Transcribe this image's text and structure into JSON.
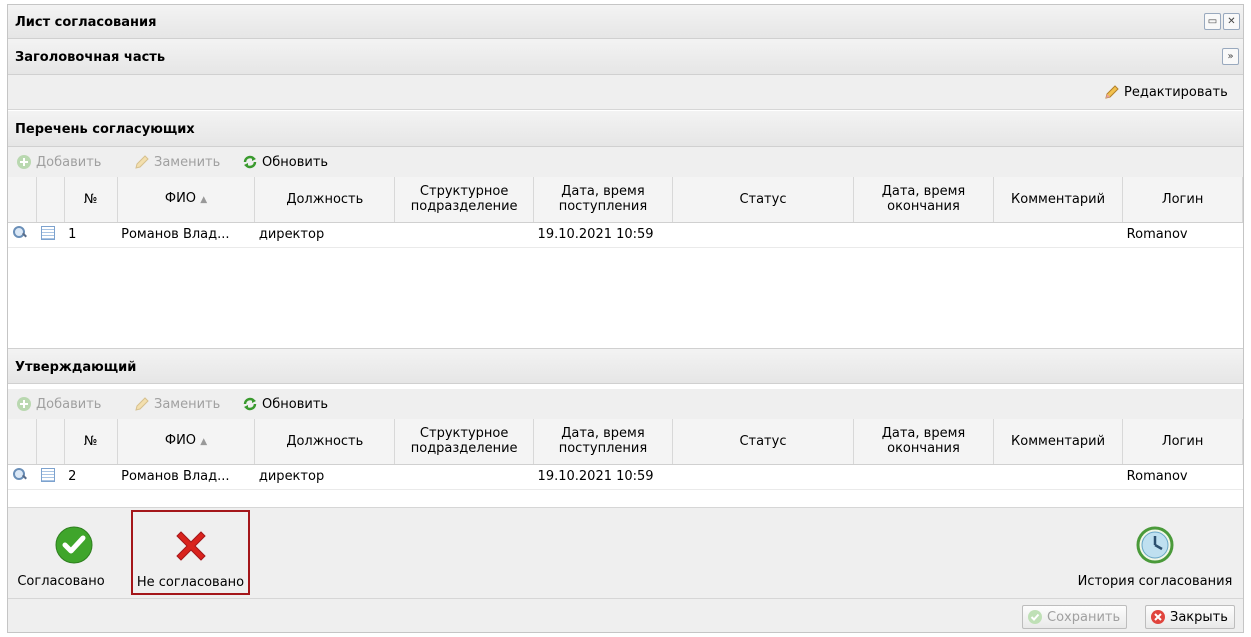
{
  "window": {
    "title": "Лист согласования"
  },
  "header_section": {
    "title": "Заголовочная часть",
    "edit_label": "Редактировать"
  },
  "approvers": {
    "title": "Перечень согласующих",
    "toolbar": {
      "add": "Добавить",
      "replace": "Заменить",
      "refresh": "Обновить"
    },
    "columns": [
      "№",
      "ФИО",
      "Должность",
      "Структурное подразделение",
      "Дата, время поступления",
      "Статус",
      "Дата, время окончания",
      "Комментарий",
      "Логин"
    ],
    "rows": [
      {
        "num": "1",
        "fio": "Романов Влад...",
        "position": "директор",
        "unit": "",
        "received": "19.10.2021 10:59",
        "status": "",
        "finished": "",
        "comment": "",
        "login": "Romanov"
      }
    ]
  },
  "confirmer": {
    "title": "Утверждающий",
    "toolbar": {
      "add": "Добавить",
      "replace": "Заменить",
      "refresh": "Обновить"
    },
    "columns": [
      "№",
      "ФИО",
      "Должность",
      "Структурное подразделение",
      "Дата, время поступления",
      "Статус",
      "Дата, время окончания",
      "Комментарий",
      "Логин"
    ],
    "rows": [
      {
        "num": "2",
        "fio": "Романов Влад...",
        "position": "директор",
        "unit": "",
        "received": "19.10.2021 10:59",
        "status": "",
        "finished": "",
        "comment": "",
        "login": "Romanov"
      }
    ]
  },
  "actions": {
    "approved": "Согласовано",
    "not_approved": "Не согласовано",
    "history": "История согласования"
  },
  "footer": {
    "save": "Сохранить",
    "close": "Закрыть"
  },
  "colors": {
    "highlight_border": "#a4161a",
    "approve_green": "#3fa52b",
    "reject_red": "#d9231d"
  }
}
